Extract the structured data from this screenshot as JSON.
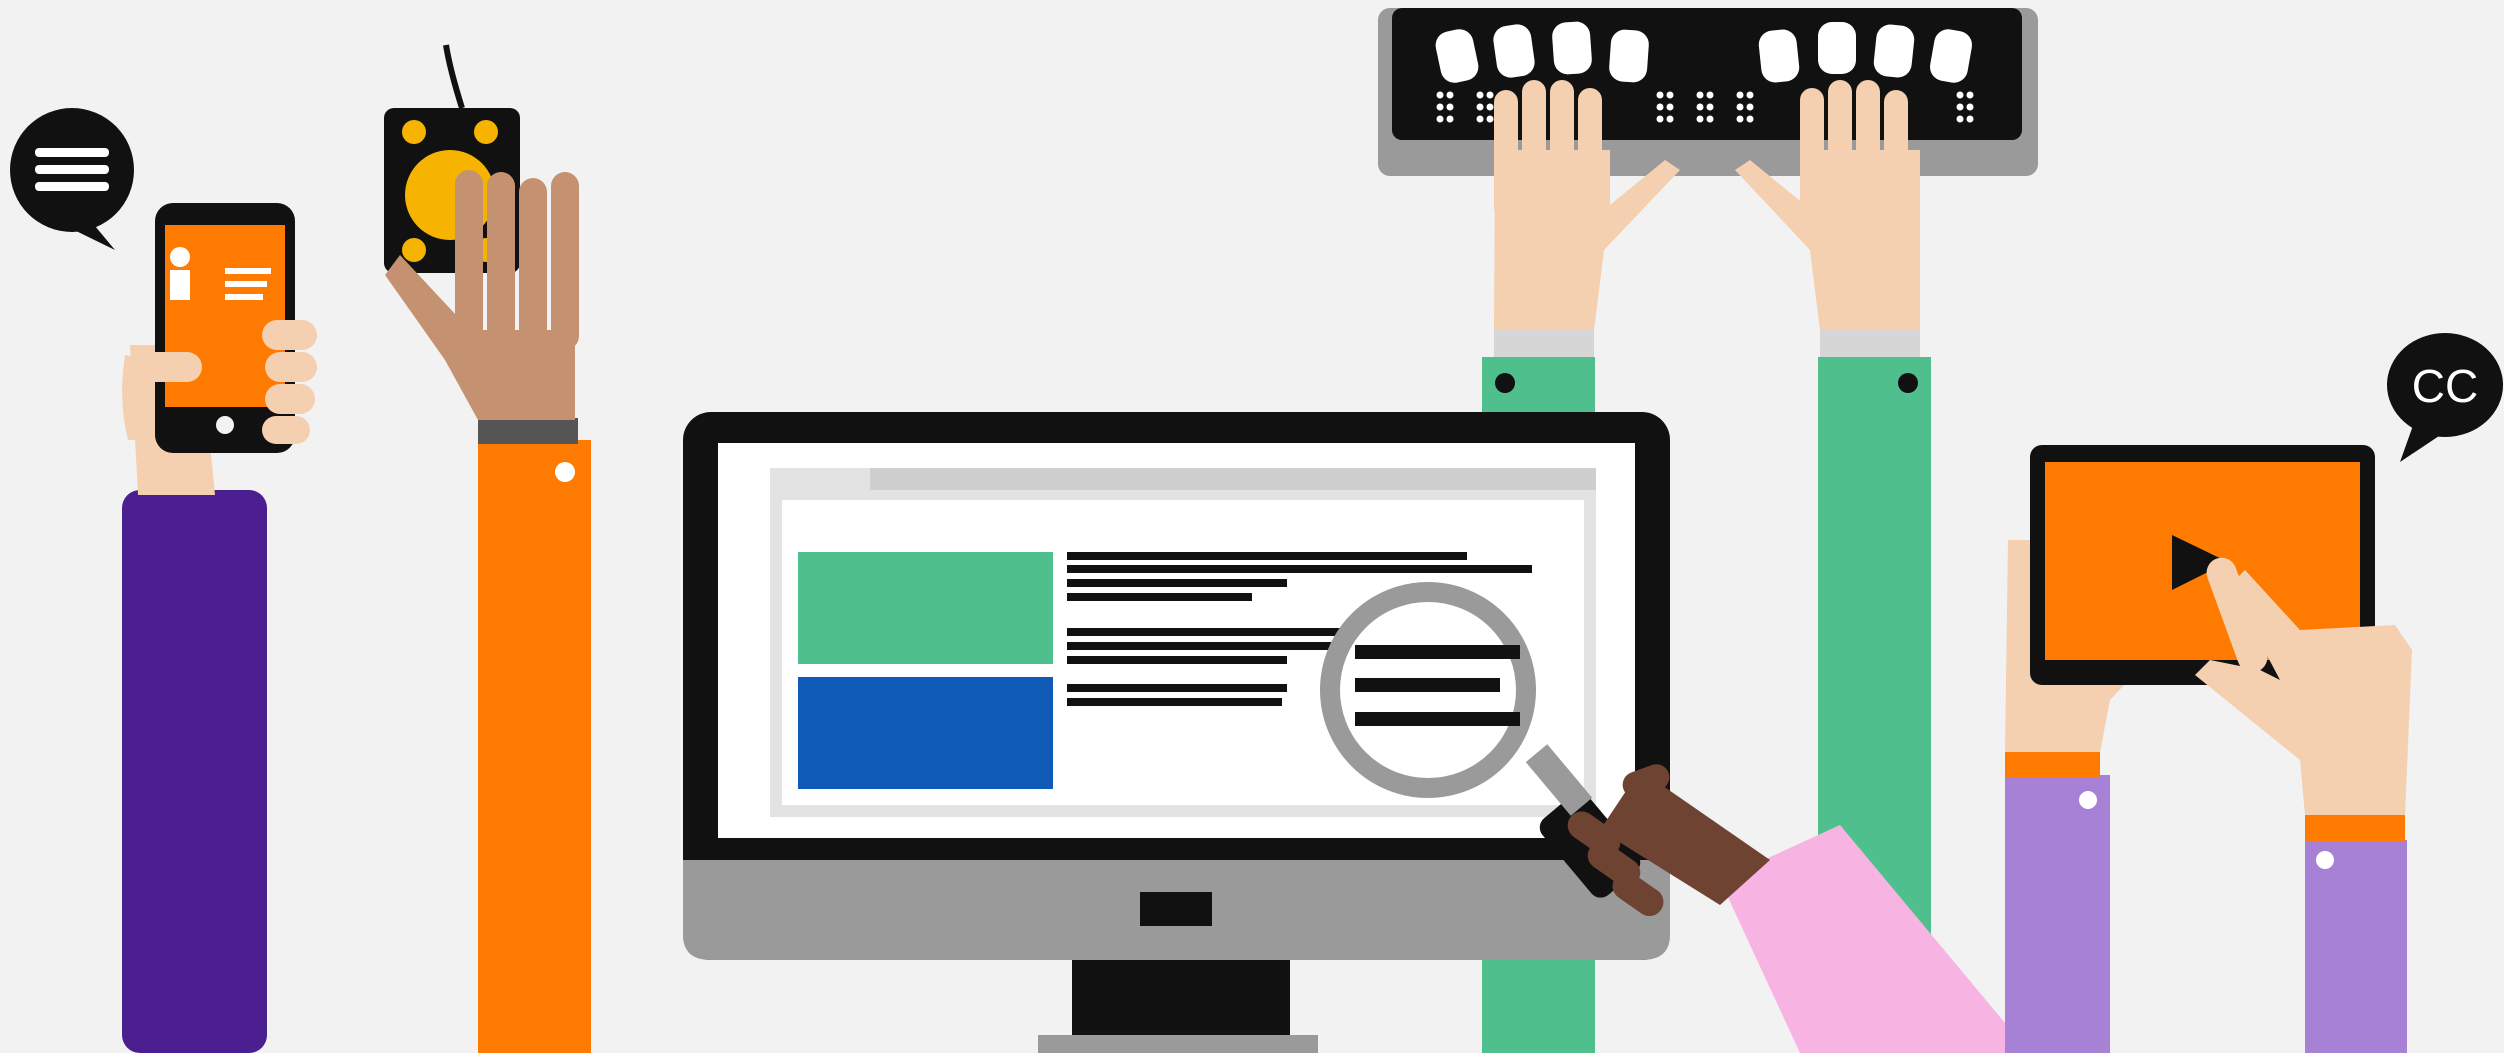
{
  "illustration": {
    "caption_badge": "CC"
  },
  "colors": {
    "background": "#f2f2f2",
    "ink": "#111111",
    "orange": "#ff7a00",
    "purple": "#4b1f8f",
    "green": "#4fc08d",
    "blue": "#105ab8",
    "lavender": "#a681d6",
    "pink": "#f7b4e3",
    "gray": "#9a9a9a",
    "light_gray": "#d6d6d6",
    "skin_light": "#f4cfb0",
    "skin_medium": "#c49270",
    "skin_dark": "#6e4332",
    "switch_yellow": "#f6b400"
  },
  "icons": [
    "speech-bubble-text-icon",
    "smartphone-icon",
    "accessibility-switch-icon",
    "braille-display-icon",
    "monitor-icon",
    "magnifying-glass-icon",
    "tablet-icon",
    "play-icon",
    "closed-captions-icon"
  ]
}
